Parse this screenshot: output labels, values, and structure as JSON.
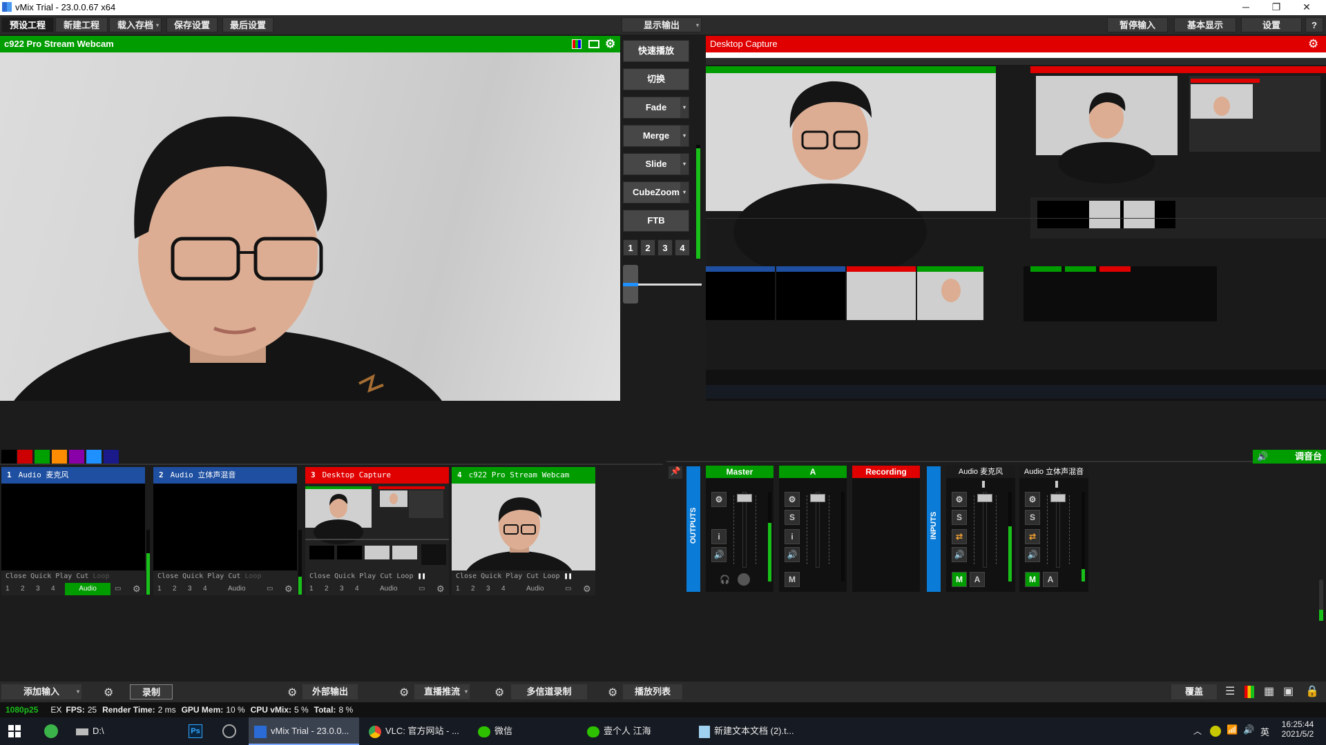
{
  "window": {
    "title": "vMix Trial - 23.0.0.67 x64",
    "minimize": "─",
    "maximize": "❐",
    "close": "✕"
  },
  "menu": {
    "items": [
      "预设工程",
      "新建工程",
      "载入存档",
      "保存设置",
      "最后设置"
    ],
    "display_output": "显示输出",
    "right": [
      "暂停输入",
      "基本显示",
      "设置"
    ],
    "help": "?"
  },
  "preview": {
    "title": "c922 Pro Stream Webcam"
  },
  "output": {
    "title": "Desktop Capture"
  },
  "transitions": {
    "quick_play": "快速播放",
    "cut": "切换",
    "fade": "Fade",
    "merge": "Merge",
    "slide": "Slide",
    "cubezoom": "CubeZoom",
    "ftb": "FTB",
    "numbers": [
      "1",
      "2",
      "3",
      "4"
    ]
  },
  "colors": {
    "green": "#009c00",
    "red": "#e00000",
    "blue": "#1e4fa0",
    "accent_blue": "#0a7bd6",
    "swatches": [
      "#000000",
      "#cc0000",
      "#00a000",
      "#ff8c00",
      "#8a00a8",
      "#1e90ff",
      "#1a1a8a"
    ]
  },
  "inputs": [
    {
      "num": "1",
      "name": "Audio 麦克风",
      "color": "#1e4fa0"
    },
    {
      "num": "2",
      "name": "Audio 立体声混音",
      "color": "#1e4fa0"
    },
    {
      "num": "3",
      "name": "Desktop Capture",
      "color": "#e00000"
    },
    {
      "num": "4",
      "name": "c922 Pro Stream Webcam",
      "color": "#009c00"
    }
  ],
  "input_controls": {
    "close": "Close",
    "quick_play": "Quick Play",
    "cut": "Cut",
    "loop": "Loop",
    "audio": "Audio",
    "numbers": [
      "1",
      "2",
      "3",
      "4"
    ]
  },
  "mixer": {
    "outputs_label": "OUTPUTS",
    "inputs_label": "INPUTS",
    "master": "Master",
    "a": "A",
    "recording": "Recording",
    "ch1": "Audio 麦克风",
    "ch2": "Audio 立体声混音",
    "s": "S",
    "i": "i",
    "m": "M",
    "label": "调音台"
  },
  "bottom": {
    "add_input": "添加输入",
    "record": "录制",
    "external": "外部输出",
    "stream": "直播推流",
    "multicorder": "多信道录制",
    "playlist": "播放列表",
    "overlay": "覆盖"
  },
  "status": {
    "res": "1080p25",
    "ex": "EX",
    "fps_label": "FPS:",
    "fps": "25",
    "render_label": "Render Time:",
    "render": "2 ms",
    "gpu_label": "GPU Mem:",
    "gpu": "10 %",
    "cpu_label": "CPU vMix:",
    "cpu": "5 %",
    "total_label": "Total:",
    "total": "8 %"
  },
  "taskbar": {
    "items": [
      "D:\\",
      "vMix Trial - 23.0.0...",
      "VLC: 官方网站 - ...",
      "微信",
      "壹个人 江海",
      "新建文本文档 (2).t..."
    ],
    "time": "16:25:44",
    "date": "2021/5/2",
    "ime": "英"
  }
}
